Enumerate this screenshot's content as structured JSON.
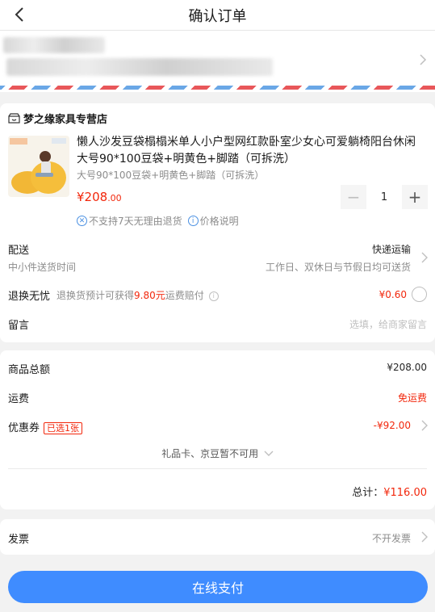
{
  "header": {
    "title": "确认订单"
  },
  "shop": {
    "name": "梦之缘家具专营店"
  },
  "product": {
    "title": "懒人沙发豆袋榻榻米单人小户型网红款卧室少女心可爱躺椅阳台休闲大号90*100豆袋+明黄色+脚踏（可拆洗）",
    "spec": "大号90*100豆袋+明黄色+脚踏（可拆洗）",
    "price_symbol_int": "¥208",
    "price_dec": ".00",
    "quantity": "1",
    "minus": "−",
    "plus": "+",
    "tag_no_return": "不支持7天无理由退货",
    "tag_price_note": "价格说明"
  },
  "delivery": {
    "label": "配送",
    "sub": "中小件送货时间",
    "method": "快递运输",
    "time": "工作日、双休日与节假日均可送货"
  },
  "insurance": {
    "label": "退换无忧",
    "desc_prefix": "退换货预计可获得",
    "amount": "9.80元",
    "desc_suffix": "运费赔付",
    "price": "¥0.60"
  },
  "message": {
    "label": "留言",
    "placeholder": "选填，给商家留言"
  },
  "summary": {
    "goods_label": "商品总额",
    "goods_value": "¥208.00",
    "shipping_label": "运费",
    "shipping_value": "免运费",
    "coupon_label": "优惠券",
    "coupon_badge": "已选1张",
    "coupon_value": "-¥92.00",
    "gift_note": "礼品卡、京豆暂不可用",
    "total_label": "总计：",
    "total_value": "¥116.00"
  },
  "invoice": {
    "label": "发票",
    "value": "不开发票"
  },
  "pay": {
    "label": "在线支付"
  },
  "colors": {
    "accent": "#3f8cff",
    "price_red": "#f2270c"
  },
  "icons": [
    "back-arrow-icon",
    "shop-icon",
    "chevron-right-icon",
    "no-return-icon",
    "info-icon",
    "chevron-down-icon"
  ]
}
